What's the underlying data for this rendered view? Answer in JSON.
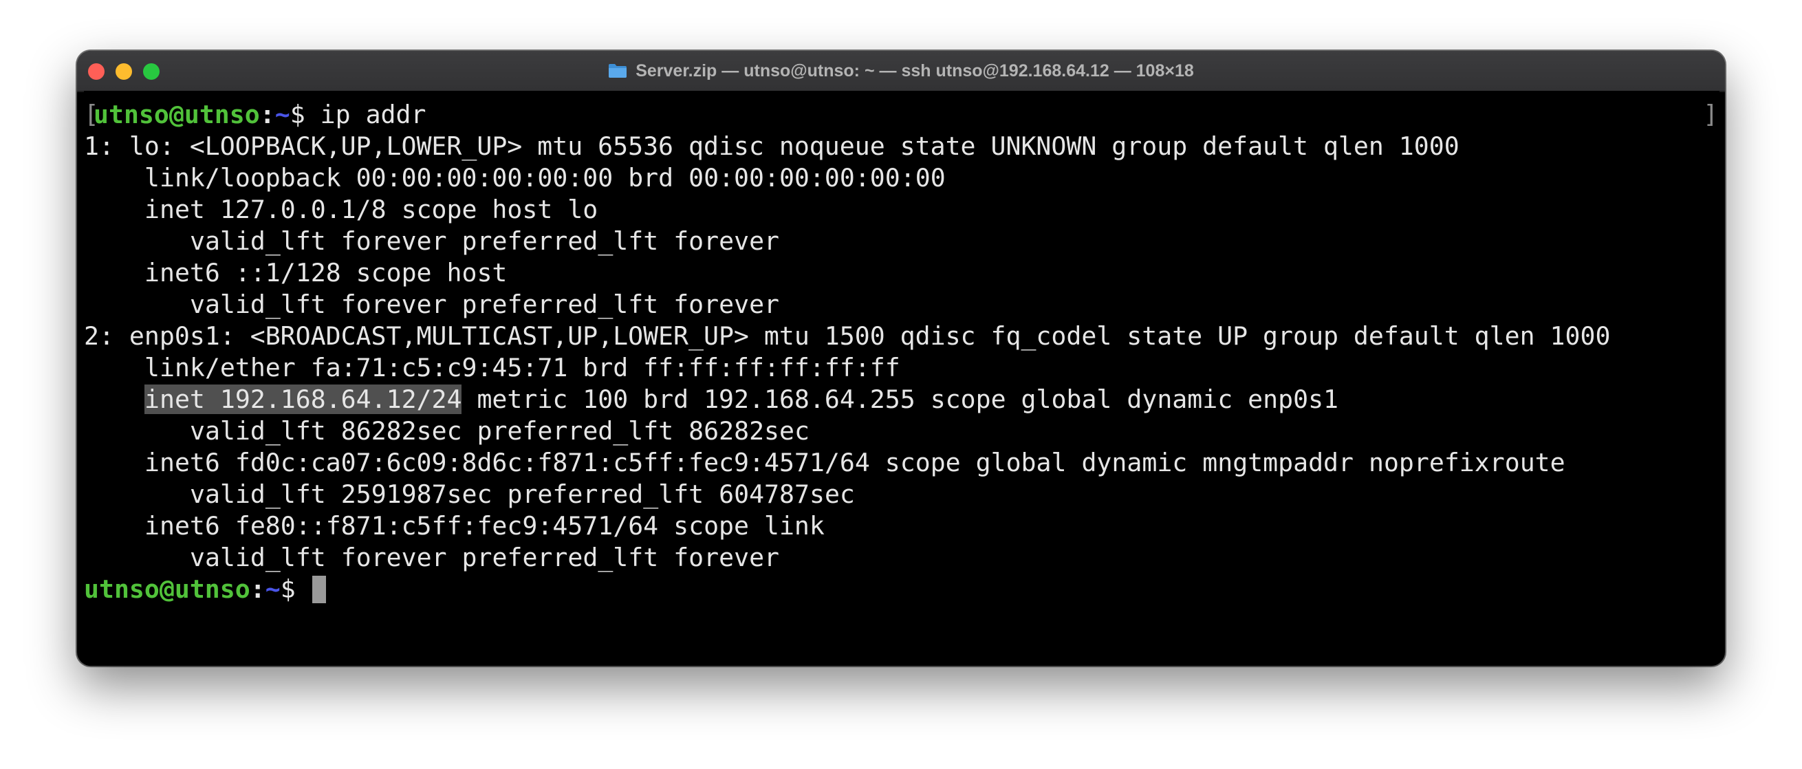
{
  "window": {
    "title": "Server.zip — utnso@utnso: ~ — ssh utnso@192.168.64.12 — 108×18",
    "folder_icon": "folder-icon",
    "traffic_colors": {
      "close": "#ff5f57",
      "minimize": "#febc2e",
      "zoom": "#28c840"
    }
  },
  "terminal": {
    "prompt": {
      "user_host": "utnso@utnso",
      "sep": ":",
      "dir": "~",
      "dollar": "$ "
    },
    "command": "ip addr",
    "lines": [
      "1: lo: <LOOPBACK,UP,LOWER_UP> mtu 65536 qdisc noqueue state UNKNOWN group default qlen 1000",
      "link/loopback 00:00:00:00:00:00 brd 00:00:00:00:00:00",
      "inet 127.0.0.1/8 scope host lo",
      "valid_lft forever preferred_lft forever",
      "inet6 ::1/128 scope host",
      "valid_lft forever preferred_lft forever",
      "2: enp0s1: <BROADCAST,MULTICAST,UP,LOWER_UP> mtu 1500 qdisc fq_codel state UP group default qlen 1000",
      "link/ether fa:71:c5:c9:45:71 brd ff:ff:ff:ff:ff:ff",
      "inet 192.168.64.12/24",
      " metric 100 brd 192.168.64.255 scope global dynamic enp0s1",
      "valid_lft 86282sec preferred_lft 86282sec",
      "inet6 fd0c:ca07:6c09:8d6c:f871:c5ff:fec9:4571/64 scope global dynamic mngtmpaddr noprefixroute",
      "valid_lft 2591987sec preferred_lft 604787sec",
      "inet6 fe80::f871:c5ff:fec9:4571/64 scope link",
      "valid_lft forever preferred_lft forever"
    ],
    "bracket_left": "[",
    "bracket_right": "]",
    "colors": {
      "user": "#51c23a",
      "dir": "#4a55e8",
      "text": "#e6e6e6",
      "selection": "#505050"
    }
  }
}
